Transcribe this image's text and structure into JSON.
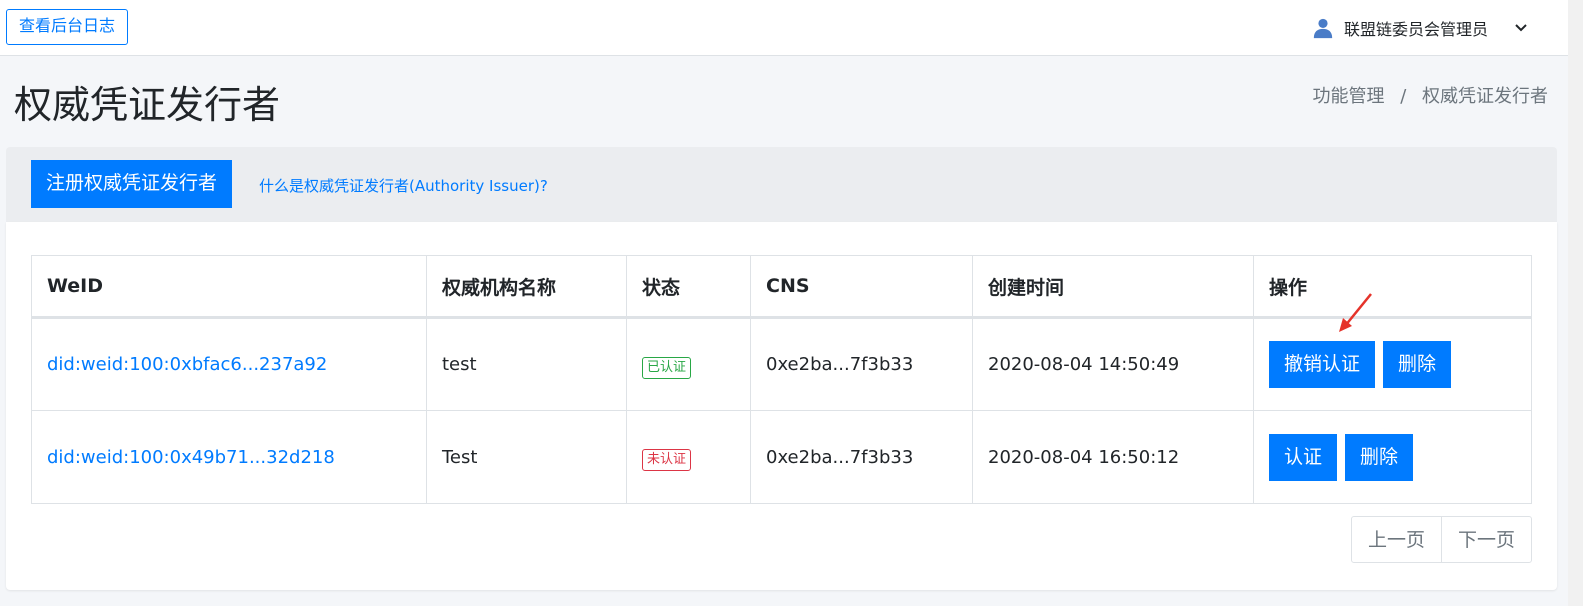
{
  "header": {
    "log_button": "查看后台日志",
    "user_name": "联盟链委员会管理员"
  },
  "page": {
    "title": "权威凭证发行者",
    "breadcrumb": [
      "功能管理",
      "/",
      "权威凭证发行者"
    ]
  },
  "actions": {
    "register_label": "注册权威凭证发行者",
    "help_text": "什么是权威凭证发行者(Authority Issuer)?"
  },
  "table": {
    "headers": [
      "WeID",
      "权威机构名称",
      "状态",
      "CNS",
      "创建时间",
      "操作"
    ],
    "rows": [
      {
        "weid": "did:weid:100:0xbfac6...237a92",
        "name": "test",
        "status": "已认证",
        "cns": "0xe2ba...7f3b33",
        "created": "2020-08-04 14:50:49",
        "actions": [
          "撤销认证",
          "删除"
        ]
      },
      {
        "weid": "did:weid:100:0x49b71...32d218",
        "name": "Test",
        "status": "未认证",
        "cns": "0xe2ba...7f3b33",
        "created": "2020-08-04 16:50:12",
        "actions": [
          "认证",
          "删除"
        ]
      }
    ]
  },
  "pager": {
    "prev": "上一页",
    "next": "下一页"
  },
  "colors": {
    "primary": "#007bff",
    "verified": "#28a745",
    "unverified": "#dc3545",
    "annotation_arrow": "#e5332a"
  },
  "icons": {
    "user": "user-icon",
    "dropdown": "chevron-down-icon",
    "annotation": "red-arrow-annotation"
  }
}
